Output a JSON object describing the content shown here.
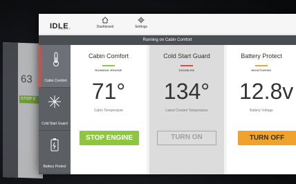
{
  "ghost": {
    "value": "63",
    "button": "STOP E"
  },
  "topbar": {
    "logo_main": "IDLE",
    "logo_sub": "SMART",
    "nav": [
      {
        "label": "Dashboard",
        "icon": "home-icon"
      },
      {
        "label": "Settings",
        "icon": "gear-icon"
      }
    ]
  },
  "status": {
    "text": "Running on Cabin Comfort"
  },
  "sidebar": {
    "items": [
      {
        "label": "Cabin Comfort",
        "icon": "thermometer-icon",
        "active": true
      },
      {
        "label": "Cold Start Guard",
        "icon": "snowflake-icon",
        "active": false
      },
      {
        "label": "Battery Protect",
        "icon": "battery-icon",
        "active": false
      }
    ]
  },
  "panels": [
    {
      "title": "Cabin Comfort",
      "state": "RUNNING ENGINE",
      "value": "71°",
      "label": "Cabin Temperature",
      "button": "STOP ENGINE",
      "accent": "#8ec63f",
      "bg": "#ffffff"
    },
    {
      "title": "Cold Start Guard",
      "state": "DISABLED",
      "value": "134°",
      "label": "Latest Coolant Temperature",
      "button": "TURN ON",
      "accent": "#e3483c",
      "bg": "#dcdcdc"
    },
    {
      "title": "Battery Protect",
      "state": "MONITORING",
      "value": "12.8v",
      "label": "Battery Voltage",
      "button": "TURN OFF",
      "accent": "#f0a22e",
      "bg": "#ffffff"
    }
  ]
}
